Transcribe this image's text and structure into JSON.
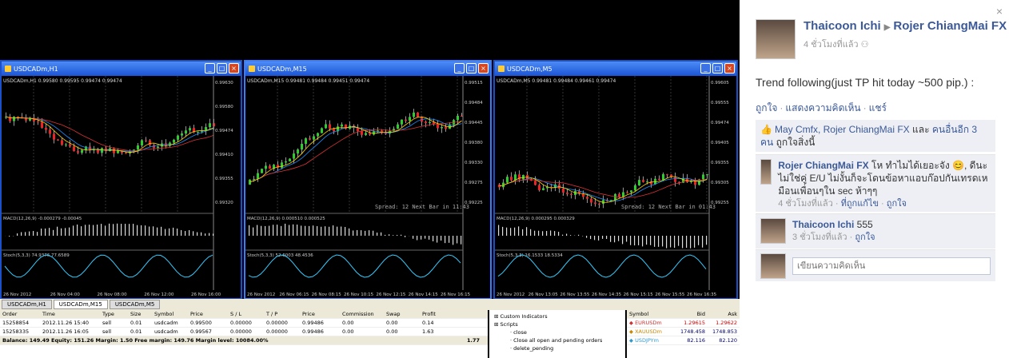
{
  "charts": [
    {
      "title": "USDCADm,H1",
      "info": "USDCADm,H1  0.99580 0.99595 0.99474 0.99474",
      "macd_label": "MACD(12,26,9) -0.000279  -0.00045",
      "stoch_label": "Stoch(5,3,3) 74.9376 77.6589",
      "time_axis": [
        "26 Nov 2012",
        "26 Nov 04:00",
        "26 Nov 08:00",
        "26 Nov 12:00",
        "26 Nov 16:00"
      ],
      "price_axis": [
        "0.99630",
        "0.99580",
        "0.99474",
        "0.99410",
        "0.99355",
        "0.99320"
      ]
    },
    {
      "title": "USDCADm,M15",
      "info": "USDCADm,M15  0.99481 0.99484 0.99451 0.99474",
      "macd_label": "MACD(12,26,9) 0.000510  0.000525",
      "stoch_label": "Stoch(5,3,3) 52.6003 48.4536",
      "spread_text": "Spread: 12  Next Bar in 11:43",
      "time_axis": [
        "26 Nov 2012",
        "26 Nov 06:15",
        "26 Nov 08:15",
        "26 Nov 10:15",
        "26 Nov 12:15",
        "26 Nov 14:15",
        "26 Nov 16:15"
      ],
      "price_axis": [
        "0.99515",
        "0.99484",
        "0.99445",
        "0.99380",
        "0.99330",
        "0.99275",
        "0.99225"
      ]
    },
    {
      "title": "USDCADm,M5",
      "info": "USDCADm,M5  0.99481 0.99484 0.99461 0.99474",
      "macd_label": "MACD(12,26,9) 0.000295  0.000329",
      "stoch_label": "Stoch(5,3,3) 16.1533 18.5334",
      "spread_text": "Spread: 12  Next Bar in 01:43",
      "time_axis": [
        "26 Nov 2012",
        "26 Nov 13:05",
        "26 Nov 13:55",
        "26 Nov 14:35",
        "26 Nov 15:15",
        "26 Nov 15:55",
        "26 Nov 16:35"
      ],
      "price_axis": [
        "0.99605",
        "0.99555",
        "0.99474",
        "0.99405",
        "0.99355",
        "0.99305",
        "0.99255"
      ]
    }
  ],
  "panel_tabs": [
    "USDCADm,H1",
    "USDCADm,M15",
    "USDCADm,M5"
  ],
  "terminal": {
    "headers": [
      "Order",
      "Time",
      "Type",
      "Size",
      "Symbol",
      "Price",
      "S / L",
      "T / P",
      "Price",
      "Commission",
      "Swap",
      "Profit"
    ],
    "rows": [
      [
        "15258854",
        "2012.11.26 15:40",
        "sell",
        "0.01",
        "usdcadm",
        "0.99500",
        "0.00000",
        "0.00000",
        "0.99486",
        "0.00",
        "0.00",
        "0.14"
      ],
      [
        "15258335",
        "2012.11.26 16:05",
        "sell",
        "0.01",
        "usdcadm",
        "0.99567",
        "0.00000",
        "0.00000",
        "0.99486",
        "0.00",
        "0.00",
        "1.63"
      ]
    ],
    "balance_line": "Balance: 149.49  Equity: 151.26  Margin: 1.50  Free margin: 149.76  Margin level: 10084.00%",
    "balance_total": "1.77"
  },
  "navigator": [
    "Custom Indicators",
    "Scripts",
    "close",
    "Close all open and pending orders",
    "delete_pending"
  ],
  "market_watch": {
    "headers": [
      "Symbol",
      "Bid",
      "Ask"
    ],
    "rows": [
      [
        "EURUSDm",
        "1.29615",
        "1.29622"
      ],
      [
        "XAUUSDm",
        "1748.458",
        "1748.853"
      ],
      [
        "USDJPYm",
        "82.116",
        "82.120"
      ]
    ]
  },
  "facebook": {
    "close_label": "×",
    "author": "Thaicoon Ichi",
    "arrow": "▶",
    "target": "Rojer ChiangMai FX",
    "time": "4 ชั่วโมงที่แล้ว",
    "post_text": "Trend following(just TP hit today ~500 pip.) :",
    "actions": [
      "ถูกใจ",
      "แสดงความคิดเห็น",
      "แชร์"
    ],
    "likes_names": "May Cmfx, Rojer ChiangMai FX",
    "likes_and": " และ ",
    "likes_others": "คนอื่นอีก 3 คน",
    "likes_suffix": " ถูกใจสิ่งนี้",
    "comments": [
      {
        "author": "Rojer ChiangMai FX",
        "text": " โห ทำไมได้เยอะจัง 😊, ดีนะ ไม่ใช่คู่ E/U ไม่งั้นก็จะโดนข้อหาแอบก๊อปกันเทรดเหมือนเพื่อนๆใน sec ห้าๆๆ",
        "time": "4 ชั่วโมงที่แล้ว",
        "link1": "ที่ถูกแก้ไข",
        "link2": "ถูกใจ"
      },
      {
        "author": "Thaicoon Ichi",
        "text": " 555",
        "time": "3 ชั่วโมงที่แล้ว",
        "link2": "ถูกใจ"
      }
    ],
    "comment_placeholder": "เขียนความคิดเห็น"
  }
}
